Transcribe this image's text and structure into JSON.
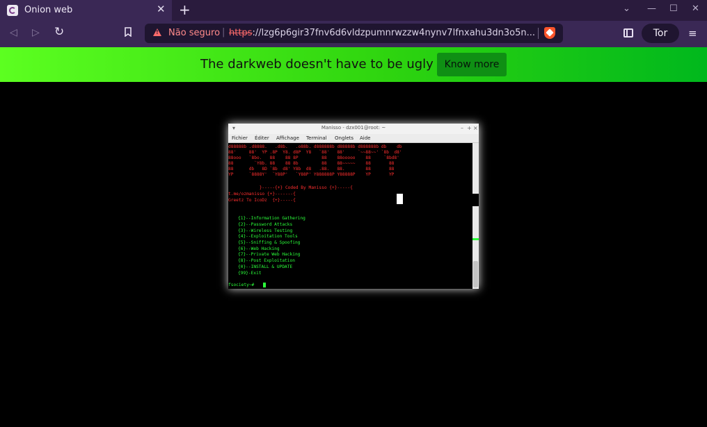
{
  "browser": {
    "tab_title": "Onion web",
    "tab_close": "✕",
    "new_tab": "+",
    "window_controls": {
      "dropdown": "⌄",
      "minimize": "—",
      "maximize": "☐",
      "close": "✕"
    },
    "nav": {
      "back": "◁",
      "forward": "▷",
      "reload": "↻",
      "bookmark": "🔖"
    },
    "url_security_label": "Não seguro",
    "url_separator": "|",
    "url_scheme": "https",
    "url_rest": "://lzg6p6gir37fnv6d6vldzpumnrwzzw4nynv7lfnxahu3dn3o5n...",
    "tor_button": "Tor",
    "menu_icon": "≡",
    "colors": {
      "tab_strip": "#2a1b3d",
      "toolbar": "#3a2855",
      "url_bg": "#1f1530",
      "warning": "#ff6b6b"
    }
  },
  "banner": {
    "text": "The darkweb doesn't have to be ugly 🛠️",
    "button_label": "Know more",
    "colors": {
      "start": "#5cff20",
      "end": "#00b81d",
      "button": "#0f8f14"
    }
  },
  "terminal": {
    "title": "Manisso - dzx001@root: ~",
    "title_controls": {
      "menu": "▾",
      "minimize": "–",
      "maximize": "+",
      "close": "×"
    },
    "menu": [
      "Fichier",
      "Éditer",
      "Affichage",
      "Terminal",
      "Onglets",
      "Aide"
    ],
    "banner_lines": [
      "d88888b .d8888.   .d8b.   .o88b. d888888b d88888b d888888b db    db",
      "88'     88'  YP .8P  Y8. d8P  Y8   `88'   88'     `~~88~~' `8b  d8'",
      "88ooo   `8bo.   88    88 8P         88    88ooooo    88     `8bd8'",
      "88        `Y8b. 88    88 8b         88    88~~~~~    88       88",
      "88      db   8D `8b  d8' Y8b  d8   .88.   88.        88       88",
      "YP      `8888Y'  `Y88P'   `Y88P' Y888888P Y88888P    YP       YP"
    ],
    "credit_line": "            }-----{+} Coded By Manisso {+}-----{",
    "contact_line": "t.me/ozmanisso {+}-------{",
    "greet_line": "Greetz To IcoDz  {+}-----{",
    "menu_items": [
      "{1}--Information Gathering",
      "{2}--Password Attacks",
      "{3}--Wireless Testing",
      "{4}--Exploitation Tools",
      "{5}--Sniffing & Spoofing",
      "{6}--Web Hacking",
      "{7}--Private Web Hacking",
      "{8}--Post Exploitation",
      "{0}--INSTALL & UPDATE",
      "{99}-Exit"
    ],
    "prompt": "fsociety~# ",
    "colors": {
      "banner": "#ff2f2f",
      "menu": "#2bff3a"
    }
  }
}
